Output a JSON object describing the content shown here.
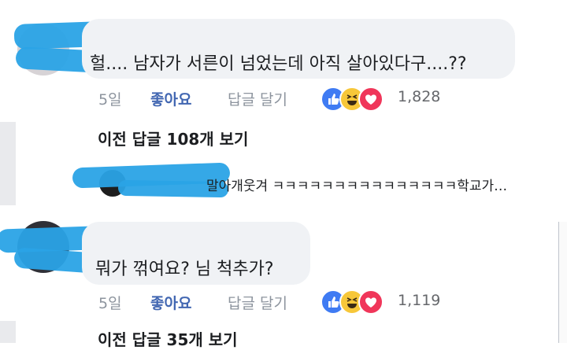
{
  "comments": [
    {
      "text": "헐.... 남자가 서른이 넘었는데 아직 살아있다구....??",
      "time": "5일",
      "like_label": "좋아요",
      "reply_label": "답글 달기",
      "reaction_count": "1,828",
      "reactions": [
        "like-icon",
        "haha-icon",
        "love-icon"
      ],
      "previous_replies": "이전 답글 108개 보기",
      "latest_reply_preview": "말아개웃겨 ㅋㅋㅋㅋㅋㅋㅋㅋㅋㅋㅋㅋㅋㅋㅋ학교가…"
    },
    {
      "text": "뭐가 꺾여요? 님 척추가?",
      "time": "5일",
      "like_label": "좋아요",
      "reply_label": "답글 달기",
      "reaction_count": "1,119",
      "reactions": [
        "like-icon",
        "haha-icon",
        "love-icon"
      ],
      "previous_replies": "이전 답글 35개 보기"
    }
  ],
  "colors": {
    "link": "#4267b2",
    "muted": "#8d949e",
    "bubble": "#f0f2f5",
    "redaction": "#2aa3e6",
    "like_reaction": "#3f7bf3",
    "haha_reaction": "#f7c739",
    "love_reaction": "#f0365a"
  }
}
